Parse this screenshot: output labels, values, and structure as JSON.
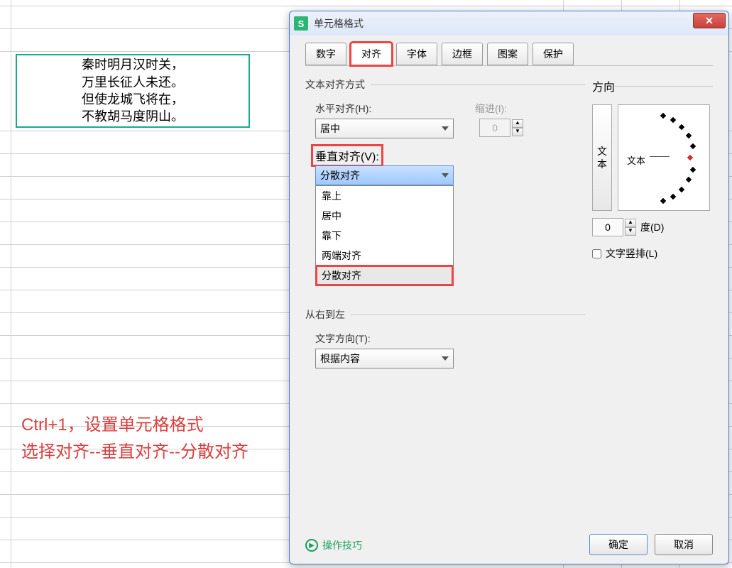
{
  "cell_text": {
    "line1": "秦时明月汉时关，",
    "line2": "万里长征人未还。",
    "line3": "但使龙城飞将在，",
    "line4": "不教胡马度阴山。"
  },
  "annotation": {
    "line1": "Ctrl+1，设置单元格格式",
    "line2": "选择对齐--垂直对齐--分散对齐"
  },
  "dialog": {
    "title": "单元格格式",
    "tabs": [
      "数字",
      "对齐",
      "字体",
      "边框",
      "图案",
      "保护"
    ],
    "active_tab_index": 1,
    "align_group": "文本对齐方式",
    "h_align_label": "水平对齐(H):",
    "h_align_value": "居中",
    "indent_label": "缩进(I):",
    "indent_value": "0",
    "v_align_label": "垂直对齐(V):",
    "v_align_value": "分散对齐",
    "v_align_options": [
      "靠上",
      "居中",
      "靠下",
      "两端对齐",
      "分散对齐"
    ],
    "rtl_group": "从右到左",
    "text_dir_label": "文字方向(T):",
    "text_dir_value": "根据内容",
    "direction_group": "方向",
    "vert_btn_text": "文本",
    "angle_text": "文本",
    "degree_value": "0",
    "degree_label": "度(D)",
    "vertical_text_chk": "文字竖排(L)",
    "hint": "操作技巧",
    "ok": "确定",
    "cancel": "取消"
  }
}
